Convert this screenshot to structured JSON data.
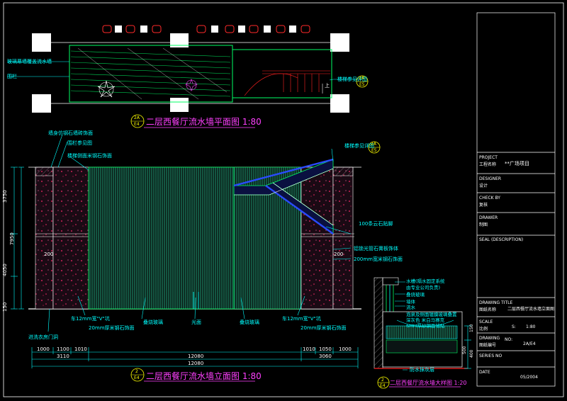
{
  "plan": {
    "title": "二层西餐厅流水墙平面图 1:80",
    "ref_top": "2A",
    "ref_bottom": "E4",
    "label_waterwall": "玻璃幕墙覆盖流水墙",
    "label_railing": "围栏",
    "label_stair": "楼梯参见详图",
    "label_up": "上",
    "stair_ref_top": "2A",
    "stair_ref_bottom": "E5"
  },
  "elevation": {
    "title": "二层西餐厅流水墙立面图 1:80",
    "ref_top": "2",
    "ref_bottom": "E4",
    "label_stone_finish": "墙身仿钢石墙砖饰面",
    "label_railing": "围栏参见图",
    "label_stair_stone": "楼梯侧面米钢石饰面",
    "label_stair_detail": "楼梯参见详图",
    "stair_ref_top": "2A",
    "stair_ref_bottom": "E5",
    "label_cloud_stone": "100条云石贴脚",
    "label_glass_strip": "铝锁光管石膏板饰体",
    "label_mm_stone": "200mm宽米钢石饰面",
    "label_v_groove_left": "车12mm宽\"V\"坑",
    "label_stone_left": "20mm厚米钢石饰面",
    "label_glass_a": "叠烧玻璃",
    "label_light": "光面",
    "label_glass_b": "叠烧玻璃",
    "label_v_groove_right": "车12mm宽\"V\"坑",
    "label_stone_right": "20mm厚米钢石饰面",
    "label_entry": "进洗衣房门洞",
    "elev_200_a": "200",
    "elev_200_b": "200",
    "dim_left_vertical": [
      "3750",
      "7950",
      "4050",
      "150"
    ],
    "dim_row1": [
      "1000",
      "1100",
      "1010",
      "1010",
      "1050",
      "1000"
    ],
    "dim_row2": [
      "3110",
      "12080",
      "3060"
    ],
    "dim_total": "12080"
  },
  "detail": {
    "title": "二层西餐厅流水墙大样图 1:20",
    "ref_top": "2",
    "ref_bottom": "E4",
    "notes": [
      "水槽(隔水固定系统",
      "由专业公司负责)",
      "叠烧玻璃",
      "墙体",
      "流水",
      "泡泉及侧面镀膜玻璃叠置",
      "深灰色 米白马赛克",
      "6MM厚砂钢面铺贴"
    ],
    "label_waterproof": "防水抹灰层",
    "dims": [
      "150",
      "400",
      "500"
    ]
  },
  "title_block": {
    "project_label_en": "PROJECT",
    "project_label_cn": "工程名称",
    "project_value": "**广场项目",
    "designer_en": "DESIGNER",
    "designer_cn": "设计",
    "check_en": "CHECK BY",
    "check_cn": "复核",
    "drawer_en": "DRAWER",
    "drawer_cn": "制图",
    "seal_en": "SEAL (DESCRIPTION)",
    "drawing_title_en": "DRAWING TITLE",
    "drawing_title_cn": "图纸名称",
    "drawing_title_value": "二层西餐厅流水墙立面图",
    "scale_en": "SCALE",
    "scale_cn": "比例",
    "scale_value": "1:80",
    "scale_prefix": "S:",
    "drawing_no_en": "DRAWING",
    "drawing_no_cn": "图纸编号",
    "drawing_no_prefix": "NO:",
    "drawing_no_value": "2A/E4",
    "series_en": "SERIES NO",
    "date_en": "DATE",
    "date_value": "05/2004"
  },
  "colors": {
    "line_white": "#ffffff",
    "line_green": "#00ff66",
    "line_cyan": "#00ffff",
    "line_magenta": "#ff00ff",
    "line_red": "#ff2020",
    "line_blue": "#2a4bff",
    "line_yellow": "#ffff00",
    "text_cyan": "#00ffff",
    "text_magenta": "#ff40ff"
  }
}
